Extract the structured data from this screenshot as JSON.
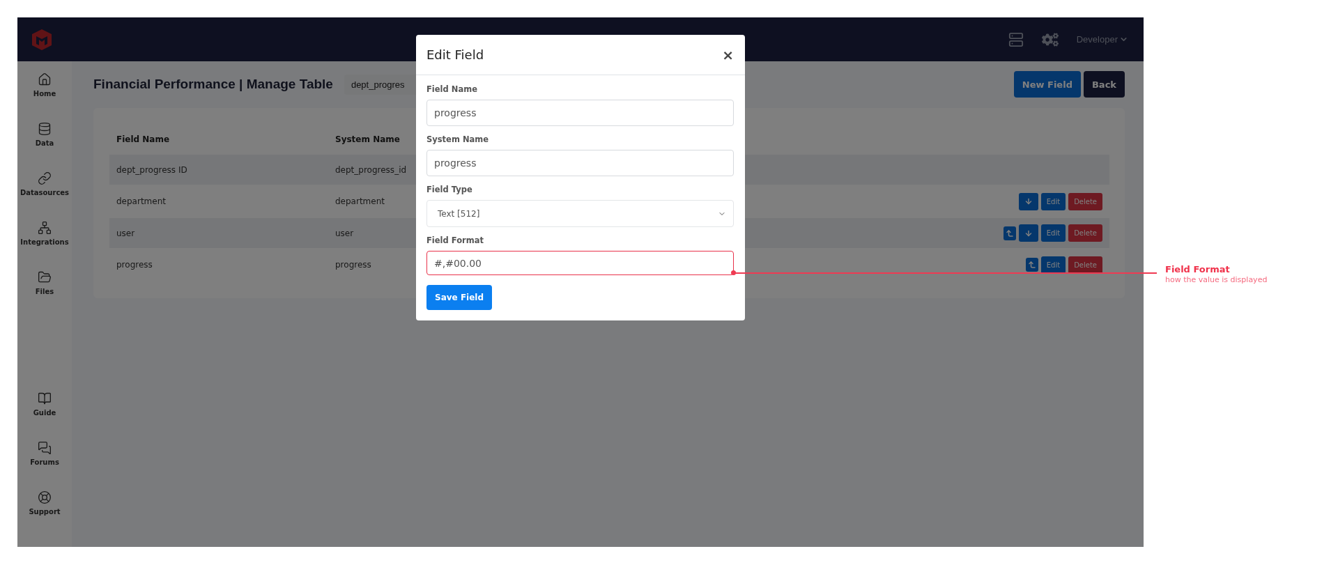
{
  "topbar": {
    "user_menu": "Developer"
  },
  "sidebar": {
    "items": [
      {
        "kind": "home",
        "label": "Home"
      },
      {
        "kind": "data",
        "label": "Data"
      },
      {
        "kind": "link",
        "label": "Datasources"
      },
      {
        "kind": "network",
        "label": "Integrations"
      },
      {
        "kind": "folder",
        "label": "Files"
      }
    ],
    "bottom_items": [
      {
        "kind": "book",
        "label": "Guide"
      },
      {
        "kind": "chat",
        "label": "Forums"
      },
      {
        "kind": "lifebuoy",
        "label": "Support"
      }
    ]
  },
  "page": {
    "title": "Financial Performance | Manage Table",
    "table_select": "dept_progres",
    "buttons": [
      {
        "kind": "primary",
        "label": "New Field"
      },
      {
        "kind": "dark",
        "label": "Back"
      }
    ]
  },
  "table": {
    "columns": [
      "Field Name",
      "System Name"
    ],
    "rows": [
      {
        "cells": [
          "dept_progress ID",
          "dept_progress_id"
        ],
        "actions": []
      },
      {
        "cells": [
          "department",
          "department"
        ],
        "actions": [
          {
            "kind": "down"
          },
          {
            "kind": "edit",
            "label": "Edit"
          },
          {
            "kind": "delete",
            "label": "Delete"
          }
        ]
      },
      {
        "cells": [
          "user",
          "user"
        ],
        "actions": [
          {
            "kind": "up"
          },
          {
            "kind": "down"
          },
          {
            "kind": "edit",
            "label": "Edit"
          },
          {
            "kind": "delete",
            "label": "Delete"
          }
        ]
      },
      {
        "cells": [
          "progress",
          "progress"
        ],
        "actions": [
          {
            "kind": "up"
          },
          {
            "kind": "edit",
            "label": "Edit"
          },
          {
            "kind": "delete",
            "label": "Delete"
          }
        ]
      }
    ]
  },
  "modal": {
    "title": "Edit Field",
    "close": "×",
    "fields": [
      {
        "kind": "input",
        "label": "Field Name",
        "value": "progress",
        "highlighted": false
      },
      {
        "kind": "input",
        "label": "System Name",
        "value": "progress",
        "highlighted": false
      },
      {
        "kind": "select",
        "label": "Field Type",
        "value": "Text [512]",
        "highlighted": false
      },
      {
        "kind": "input",
        "label": "Field Format",
        "value": "#,#00.00",
        "highlighted": true
      }
    ],
    "save_button": "Save Field"
  },
  "annotation": {
    "title": "Field Format",
    "description": "how the value is displayed"
  }
}
